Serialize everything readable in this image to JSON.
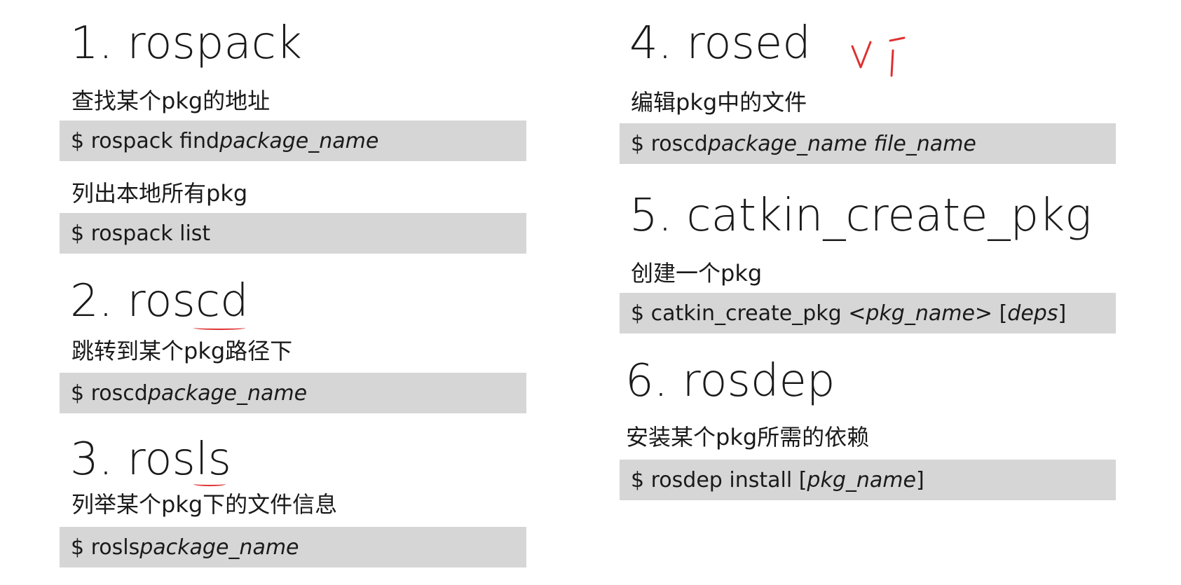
{
  "left": {
    "s1": {
      "title": "1. rospack",
      "desc_find": "查找某个pkg的地址",
      "cmd_find_prefix": "$ rospack find ",
      "cmd_find_arg": "package_name",
      "desc_list": "列出本地所有pkg",
      "cmd_list": "$ rospack list"
    },
    "s2": {
      "title": "2. roscd",
      "desc": "跳转到某个pkg路径下",
      "cmd_prefix": "$ roscd ",
      "cmd_arg": "package_name"
    },
    "s3": {
      "title": "3. rosls",
      "desc": "列举某个pkg下的文件信息",
      "cmd_prefix": "$ rosls ",
      "cmd_arg": "package_name"
    }
  },
  "right": {
    "s4": {
      "title": "4. rosed",
      "annotation": "vi",
      "desc": "编辑pkg中的文件",
      "cmd_prefix": "$ roscd ",
      "cmd_arg": "package_name file_name"
    },
    "s5": {
      "title": "5. catkin_create_pkg",
      "desc": "创建一个pkg",
      "cmd_prefix": "$ catkin_create_pkg <",
      "cmd_arg1": "pkg_name",
      "cmd_mid": "> [",
      "cmd_arg2": "deps",
      "cmd_suffix": "]"
    },
    "s6": {
      "title": "6. rosdep",
      "desc": "安装某个pkg所需的依赖",
      "cmd_prefix": "$ rosdep install [",
      "cmd_arg": "pkg_name",
      "cmd_suffix": "]"
    }
  },
  "colors": {
    "code_bg": "#d6d6d6",
    "annotation": "#e03030"
  }
}
